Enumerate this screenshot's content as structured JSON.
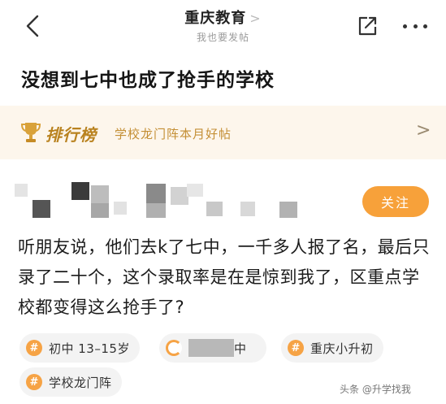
{
  "header": {
    "forum_name": "重庆教育",
    "forum_chevron": ">",
    "forum_subtitle": "我也要发帖",
    "back_icon": "chevron-left-icon",
    "share_icon": "share-out-icon",
    "more_icon": "more-dots-icon"
  },
  "post": {
    "title": "没想到七中也成了抢手的学校",
    "body": "听朋友说，他们去k了七中，一千多人报了名，最后只录了二十个，这个录取率是在是惊到我了，区重点学校都变得这么抢手了?"
  },
  "rank_banner": {
    "icon": "trophy-icon",
    "title": "排行榜",
    "description": "学校龙门阵本月好帖",
    "chevron": ">"
  },
  "author": {
    "follow_label": "关注"
  },
  "tags": [
    {
      "icon": "#",
      "label": "初中 13–15岁"
    },
    {
      "icon": "",
      "label": "中"
    },
    {
      "icon": "#",
      "label": "重庆小升初"
    },
    {
      "icon": "#",
      "label": "学校龙门阵"
    }
  ],
  "watermark": {
    "text": "头条 @升学找我"
  },
  "colors": {
    "accent_orange": "#f7a13a",
    "banner_bg": "#fdf6ec",
    "banner_text": "#b9821f"
  }
}
